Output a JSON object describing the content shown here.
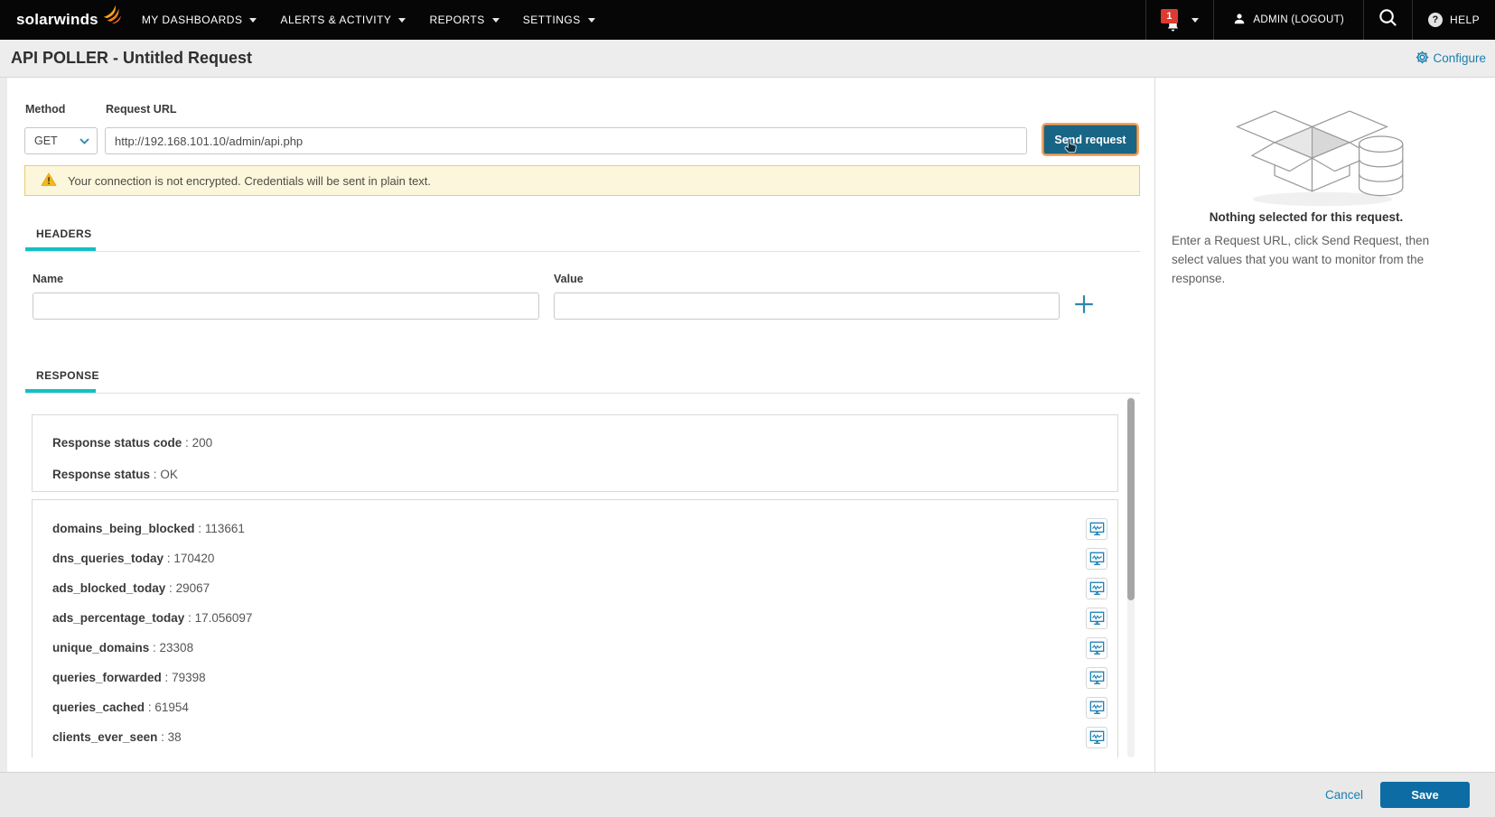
{
  "nav": {
    "brand": "solarwinds",
    "items": [
      {
        "label": "MY DASHBOARDS"
      },
      {
        "label": "ALERTS & ACTIVITY"
      },
      {
        "label": "REPORTS"
      },
      {
        "label": "SETTINGS"
      }
    ],
    "notification_count": "1",
    "account_label": "ADMIN (LOGOUT)",
    "help_label": "HELP"
  },
  "header": {
    "title": "API POLLER - Untitled Request",
    "configure_label": "Configure"
  },
  "request_bar": {
    "method_label": "Method",
    "method_value": "GET",
    "url_label": "Request URL",
    "url_value": "http://192.168.101.10/admin/api.php",
    "send_label": "Send request"
  },
  "warning": {
    "text": "Your connection is not encrypted. Credentials will be sent in plain text."
  },
  "headers_section": {
    "tab_label": "HEADERS",
    "name_label": "Name",
    "value_label": "Value"
  },
  "response_section": {
    "tab_label": "RESPONSE",
    "separator": " : ",
    "status_code_label": "Response status code",
    "status_code_value": "200",
    "status_label": "Response status",
    "status_value": "OK",
    "fields": [
      {
        "key": "domains_being_blocked",
        "value": "113661"
      },
      {
        "key": "dns_queries_today",
        "value": "170420"
      },
      {
        "key": "ads_blocked_today",
        "value": "29067"
      },
      {
        "key": "ads_percentage_today",
        "value": "17.056097"
      },
      {
        "key": "unique_domains",
        "value": "23308"
      },
      {
        "key": "queries_forwarded",
        "value": "79398"
      },
      {
        "key": "queries_cached",
        "value": "61954"
      },
      {
        "key": "clients_ever_seen",
        "value": "38"
      }
    ]
  },
  "sidebar": {
    "heading": "Nothing selected for this request.",
    "body": "Enter a Request URL, click Send Request, then select values that you want to monitor from the response."
  },
  "footer": {
    "cancel_label": "Cancel",
    "save_label": "Save"
  },
  "colors": {
    "accent_teal": "#13bfc6",
    "link_blue": "#1a7fae",
    "save_blue": "#0d6ca3",
    "send_blue": "#186586",
    "send_focus_ring": "#f0a567",
    "warning_bg": "#fcf6dc",
    "warning_border": "#e6cd73",
    "badge_red": "#dd3b2f",
    "nav_bg": "#060606"
  }
}
